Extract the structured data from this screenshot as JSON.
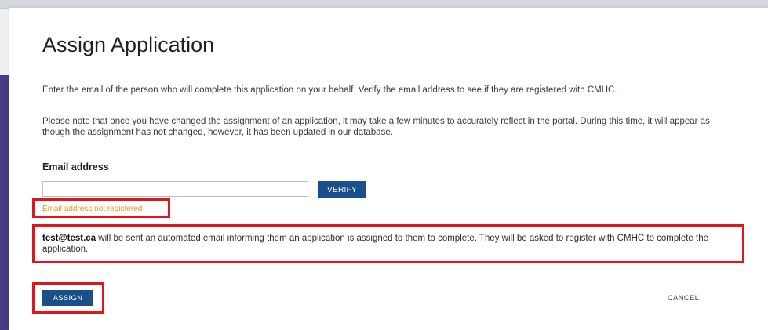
{
  "dialog": {
    "title": "Assign Application",
    "instruction_1": "Enter the email of the person who will complete this application on your behalf. Verify the email address to see if they are registered with CMHC.",
    "instruction_2": "Please note that once you have changed the assignment of an application, it may take a few minutes to accurately reflect in the portal. During this time, it will appear as though the assignment has not changed, however, it has been updated in our database."
  },
  "email": {
    "label": "Email address",
    "value": "",
    "verify_label": "VERIFY",
    "status_message": "Email address not registered"
  },
  "info": {
    "email": "test@test.ca",
    "message": " will be sent an automated email informing them an application is assigned to them to complete. They will be asked to register with CMHC to complete the application."
  },
  "actions": {
    "assign_label": "ASSIGN",
    "cancel_label": "CANCEL"
  },
  "colors": {
    "primary_button": "#1b4f8a",
    "highlight_border": "#e3141c",
    "warning_text": "#e79a1e",
    "left_band": "#4a3a86"
  }
}
